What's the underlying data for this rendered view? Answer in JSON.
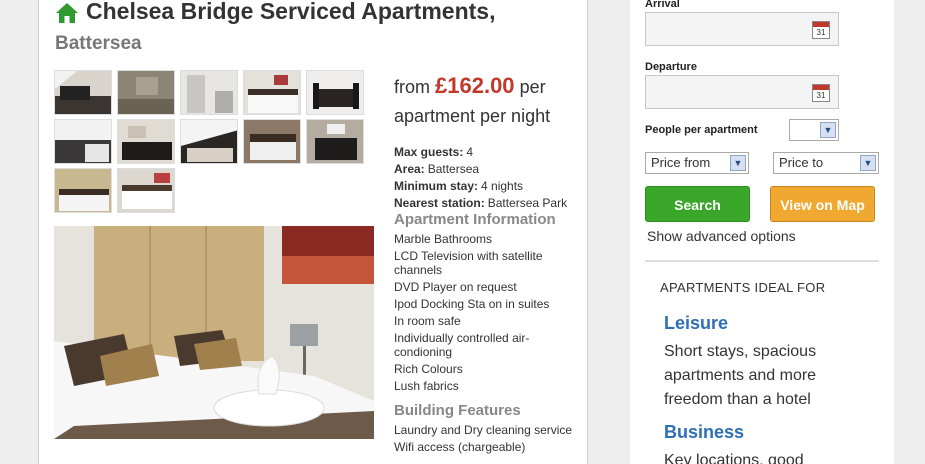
{
  "listing": {
    "title": "Chelsea Bridge Serviced Apartments,",
    "subtitle": "Battersea",
    "price_prefix": "from",
    "price": "£162.00",
    "price_suffix_1": "per",
    "price_suffix_2": "apartment per night",
    "facts": [
      {
        "label": "Max guests:",
        "value": "4"
      },
      {
        "label": "Area:",
        "value": "Battersea"
      },
      {
        "label": "Minimum stay:",
        "value": "4 nights"
      },
      {
        "label": "Nearest station:",
        "value": "Battersea Park"
      }
    ],
    "apartment_info_heading": "Apartment Information",
    "apartment_info": [
      "Marble Bathrooms",
      "LCD Television with satellite channels",
      "DVD Player on request",
      "Ipod Docking Sta on in suites",
      "In room safe",
      "Individually controlled air-condioning",
      "Rich Colours",
      "Lush fabrics"
    ],
    "building_heading": "Building Features",
    "building_features": [
      "Laundry and Dry cleaning service",
      "Wifi access (chargeable)"
    ]
  },
  "search": {
    "arrival_label": "Arrival",
    "departure_label": "Departure",
    "calendar_day": "31",
    "people_label": "People per apartment",
    "people_value": "",
    "price_from": "Price from",
    "price_to": "Price to",
    "search_button": "Search",
    "map_button": "View on Map",
    "advanced_link": "Show advanced options"
  },
  "ideal": {
    "heading": "APARTMENTS IDEAL FOR",
    "items": [
      {
        "title": "Leisure",
        "desc": "Short stays, spacious apartments and more freedom than a hotel"
      },
      {
        "title": "Business",
        "desc": "Key locations, good"
      }
    ]
  },
  "colors": {
    "price": "#c0392b",
    "search_btn": "#3aa72a",
    "map_btn": "#f0a830",
    "link_blue": "#2f6fb5",
    "home_icon": "#2f9a2f"
  }
}
